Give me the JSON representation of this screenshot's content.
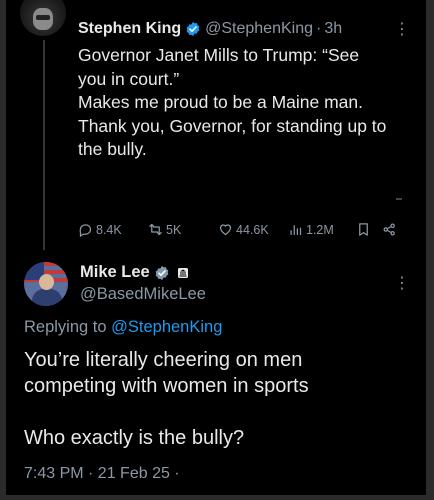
{
  "tweet1": {
    "name": "Stephen King",
    "handle": "@StephenKing",
    "separator": "·",
    "time": "3h",
    "more": "⋮",
    "lines": [
      "Governor Janet Mills to Trump: “See",
      "you in court.”",
      "Makes me proud to be a Maine man.",
      "Thank you, Governor, for standing up to",
      "the bully."
    ],
    "actions": {
      "replies": "8.4K",
      "reposts": "5K",
      "likes": "44.6K",
      "views": "1.2M"
    }
  },
  "tweet2": {
    "name": "Mike Lee",
    "handle": "@BasedMikeLee",
    "more": "⋮",
    "replying_prefix": "Replying to ",
    "replying_to": "@StephenKing",
    "line1": "You’re literally cheering on men",
    "line2": "competing with women in sports",
    "line3": "Who exactly is the bully?",
    "timestamp": "7:43 PM · 21 Feb 25 ·"
  },
  "colors": {
    "background": "#000000",
    "text": "#e7e9ea",
    "muted": "#8b98a5",
    "link": "#1d9bf0",
    "verified": "#1d9bf0"
  }
}
